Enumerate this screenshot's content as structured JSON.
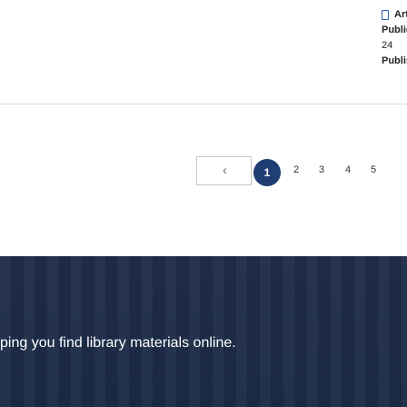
{
  "card": {
    "title": "Artic",
    "label_publication": "Publicat",
    "publication_value": "24",
    "label_published": "Publish"
  },
  "pager": {
    "prev_icon": "chevron-left-icon",
    "current": "1",
    "pages": [
      "2",
      "3",
      "4",
      "5"
    ]
  },
  "banner": {
    "text": "ping you find library materials online."
  },
  "colors": {
    "accent": "#1f3e72",
    "banner_bg": "#1f2d4a"
  }
}
